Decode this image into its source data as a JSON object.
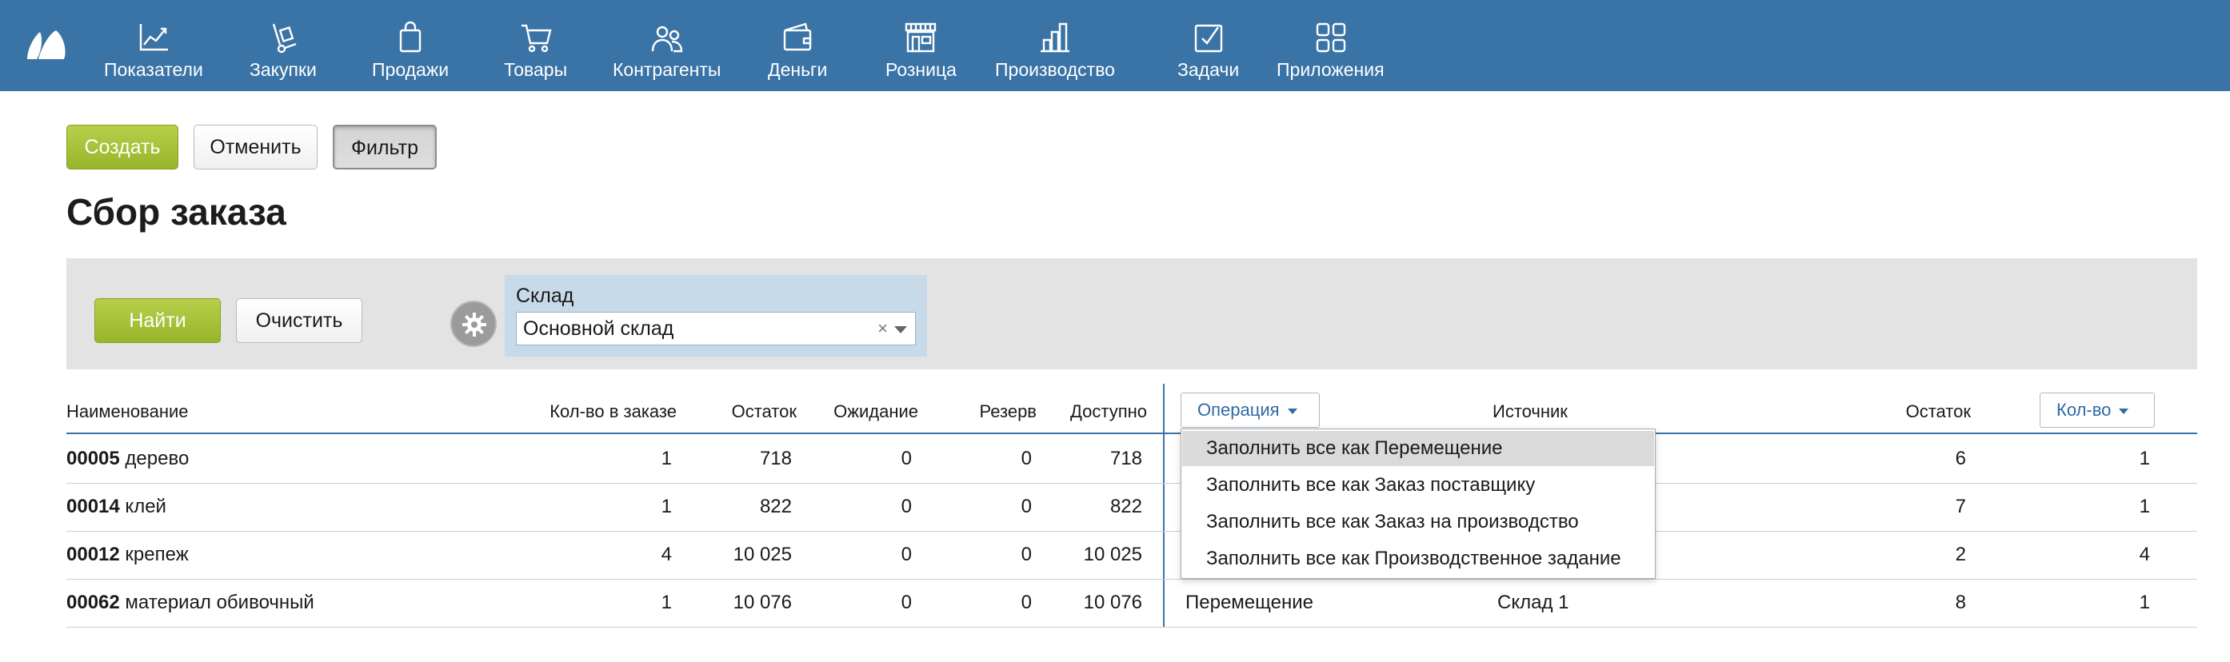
{
  "nav": {
    "items": [
      {
        "label": "Показатели",
        "icon": "chart-line-icon"
      },
      {
        "label": "Закупки",
        "icon": "hand-truck-icon"
      },
      {
        "label": "Продажи",
        "icon": "shopping-bag-icon"
      },
      {
        "label": "Товары",
        "icon": "cart-icon"
      },
      {
        "label": "Контрагенты",
        "icon": "people-icon"
      },
      {
        "label": "Деньги",
        "icon": "wallet-icon"
      },
      {
        "label": "Розница",
        "icon": "storefront-icon"
      },
      {
        "label": "Производство",
        "icon": "factory-icon"
      },
      {
        "label": "Задачи",
        "icon": "checkbox-icon"
      },
      {
        "label": "Приложения",
        "icon": "apps-icon"
      }
    ]
  },
  "toolbar": {
    "create_label": "Создать",
    "cancel_label": "Отменить",
    "filter_label": "Фильтр"
  },
  "page": {
    "title": "Сбор заказа"
  },
  "filter": {
    "find_label": "Найти",
    "clear_label": "Очистить",
    "warehouse_label": "Склад",
    "warehouse_value": "Основной склад",
    "clear_icon": "×"
  },
  "table": {
    "headers": {
      "name": "Наименование",
      "ordered": "Кол-во в заказе",
      "stock": "Остаток",
      "waiting": "Ожидание",
      "reserve": "Резерв",
      "available": "Доступно",
      "operation": "Операция",
      "source": "Источник",
      "source_stock": "Остаток",
      "qty": "Кол-во"
    },
    "rows": [
      {
        "code": "00005",
        "name": "дерево",
        "ordered": "1",
        "stock": "718",
        "waiting": "0",
        "reserve": "0",
        "available": "718",
        "operation": "",
        "source": "",
        "source_stock": "6",
        "qty": "1"
      },
      {
        "code": "00014",
        "name": "клей",
        "ordered": "1",
        "stock": "822",
        "waiting": "0",
        "reserve": "0",
        "available": "822",
        "operation": "",
        "source": "",
        "source_stock": "7",
        "qty": "1"
      },
      {
        "code": "00012",
        "name": "крепеж",
        "ordered": "4",
        "stock": "10 025",
        "waiting": "0",
        "reserve": "0",
        "available": "10 025",
        "operation": "",
        "source": "",
        "source_stock": "2",
        "qty": "4"
      },
      {
        "code": "00062",
        "name": "материал обивочный",
        "ordered": "1",
        "stock": "10 076",
        "waiting": "0",
        "reserve": "0",
        "available": "10 076",
        "operation": "Перемещение",
        "source": "Склад 1",
        "source_stock": "8",
        "qty": "1"
      }
    ]
  },
  "operation_menu": {
    "items": [
      "Заполнить все как Перемещение",
      "Заполнить все как Заказ поставщику",
      "Заполнить все как Заказ на производство",
      "Заполнить все как Производственное задание"
    ],
    "highlighted_index": 0
  },
  "colors": {
    "topbar": "#3a73a6",
    "accent_green": "#a5c13a",
    "filter_panel": "#e3e3e3",
    "warehouse_box": "#c6dae9"
  }
}
